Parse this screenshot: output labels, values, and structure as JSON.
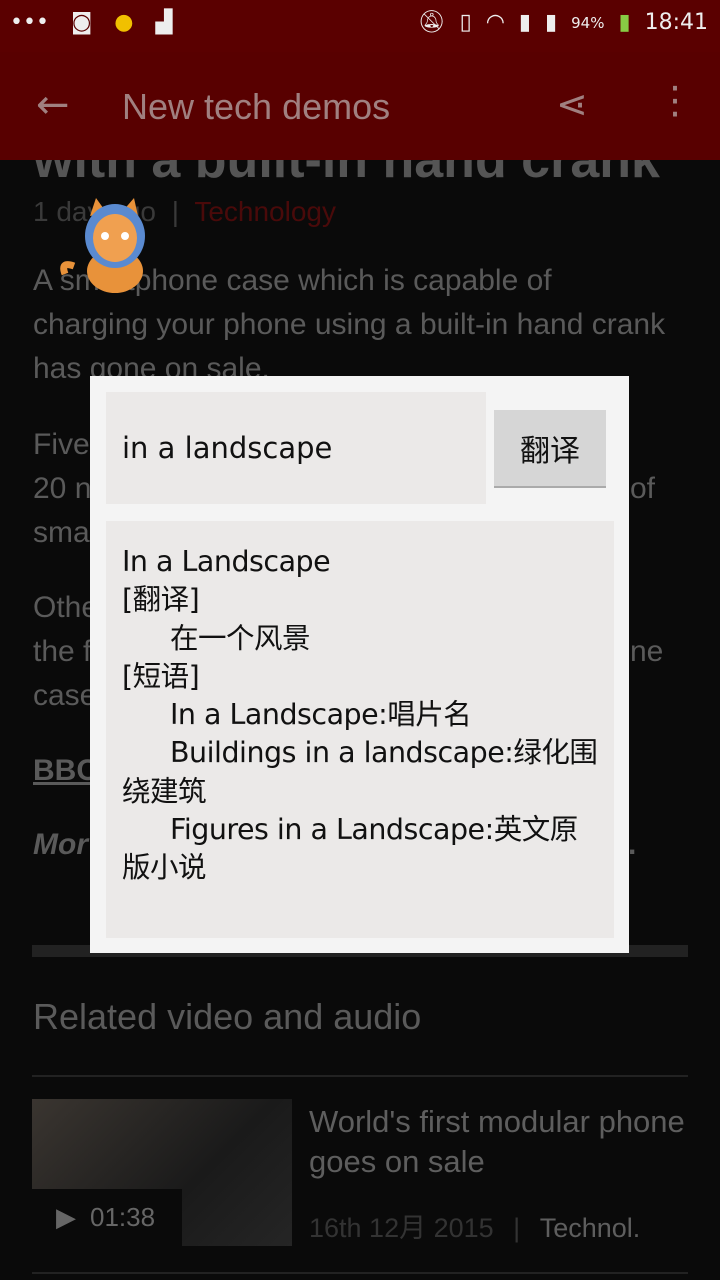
{
  "status_bar": {
    "battery": "94%",
    "time": "18:41",
    "icons": [
      "more-dots-icon",
      "screenshot-icon",
      "chat-bubble-icon",
      "android-icon",
      "mute-bell-icon",
      "vibrate-icon",
      "wifi-icon",
      "sim1-icon",
      "sim2-icon",
      "battery-charging-icon"
    ]
  },
  "toolbar": {
    "title": "New tech demos",
    "back_icon": "arrow-back-icon",
    "share_icon": "share-icon",
    "more_icon": "more-vert-icon"
  },
  "article": {
    "headline": "with a built-in hand crank",
    "time": "1 day ago",
    "separator": "|",
    "category": "Technology",
    "summary": "A smartphone case which is capable of charging your phone using a built-in hand crank has gone on sale.",
    "fragments": {
      "five": "Five",
      "twenty": "20 n",
      "of": "of",
      "sma": "sma",
      "othe": "Othe",
      "the_f": "the f",
      "ne": "ne",
      "case": "case",
      "bbc": "BBC",
      "mor": "Mor",
      "dot": "."
    }
  },
  "related": {
    "heading": "Related video and audio",
    "items": [
      {
        "title": "World's first modular phone goes on sale",
        "duration": "01:38",
        "date": "16th 12月 2015",
        "separator": "|",
        "category": "Technol."
      }
    ]
  },
  "dialog": {
    "input_value": "in a landscape",
    "translate_button": "翻译",
    "result": {
      "word": "In a Landscape",
      "translation_label": "[翻译]",
      "translation": "在一个风景",
      "phrases_label": "[短语]",
      "phrases": [
        "In a Landscape:唱片名",
        "Buildings in a landscape:绿化围绕建筑",
        "Figures in a Landscape:英文原版小说"
      ]
    }
  }
}
